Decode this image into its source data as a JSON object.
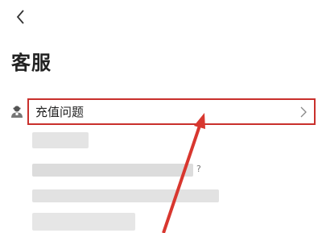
{
  "header": {
    "back_icon": "chevron-left-icon",
    "title": "客服"
  },
  "support": {
    "icon": "customer-service-icon",
    "topic_label": "充值问题",
    "topic_chevron_icon": "chevron-right-icon",
    "question_mark": "?"
  },
  "colors": {
    "highlight_border": "#c9302c",
    "arrow": "#d8372f",
    "text": "#222222",
    "blurred": "#e4e4e4"
  }
}
